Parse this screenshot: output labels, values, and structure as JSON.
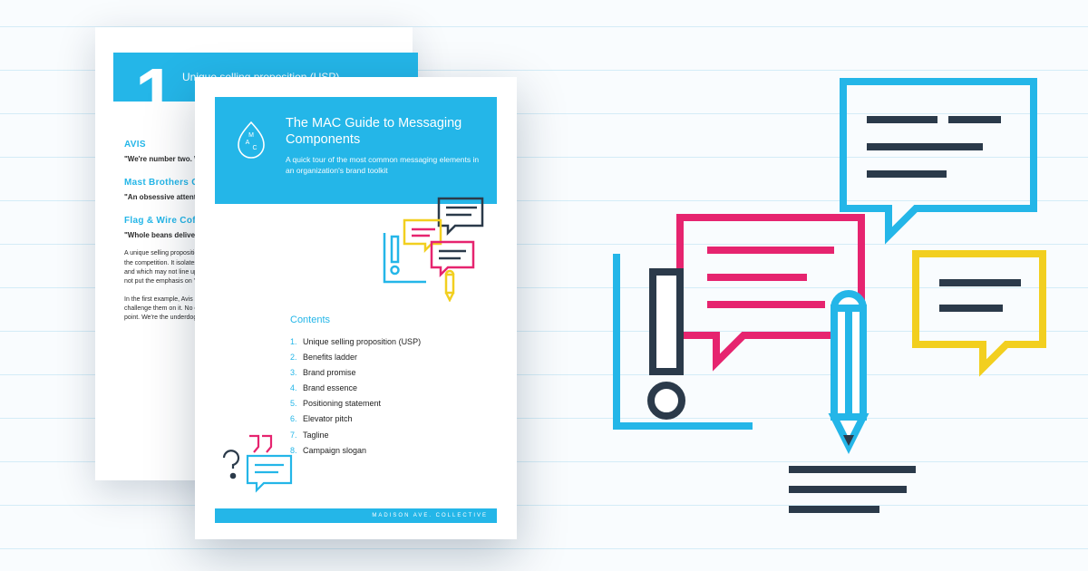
{
  "colors": {
    "cyan": "#24b6e8",
    "magenta": "#e6246f",
    "yellow": "#f2cf1f",
    "navy": "#2b3a4a",
    "white": "#ffffff"
  },
  "back_page": {
    "chapter_number": "1",
    "chapter_title": "Unique selling proposition (USP)",
    "examples": [
      {
        "brand": "AVIS",
        "quote": "\"We're number two. We try harder.\""
      },
      {
        "brand": "Mast Brothers Chocolate",
        "quote": "\"An obsessive attention to detail.\""
      },
      {
        "brand": "Flag & Wire Coffee",
        "quote": "\"Whole beans delivered to your door on a Sunday morning.\""
      }
    ],
    "para1": "A unique selling proposition answers the question of why a customer should choose you over the competition. It isolates the single thing you do well, which your competitors can't easily copy, and which may not line up with why customers think they buy from you. Ideally it will, but let's not put the emphasis on \"U\".",
    "para2": "In the first example, Avis stakes out the number two position. Their main competitor (Hertz) can't challenge them on it. No other brand has taken that unique attribute and owned it as a selling point. We're the underdog, and we'll outperform the big fish."
  },
  "front_page": {
    "title": "The MAC Guide to Messaging Components",
    "subtitle": "A quick tour of the most common messaging elements in an organization's brand toolkit",
    "contents_label": "Contents",
    "contents": [
      "Unique selling proposition (USP)",
      "Benefits ladder",
      "Brand promise",
      "Brand essence",
      "Positioning statement",
      "Elevator pitch",
      "Tagline",
      "Campaign slogan"
    ],
    "footer": "MADISON AVE. COLLECTIVE"
  }
}
